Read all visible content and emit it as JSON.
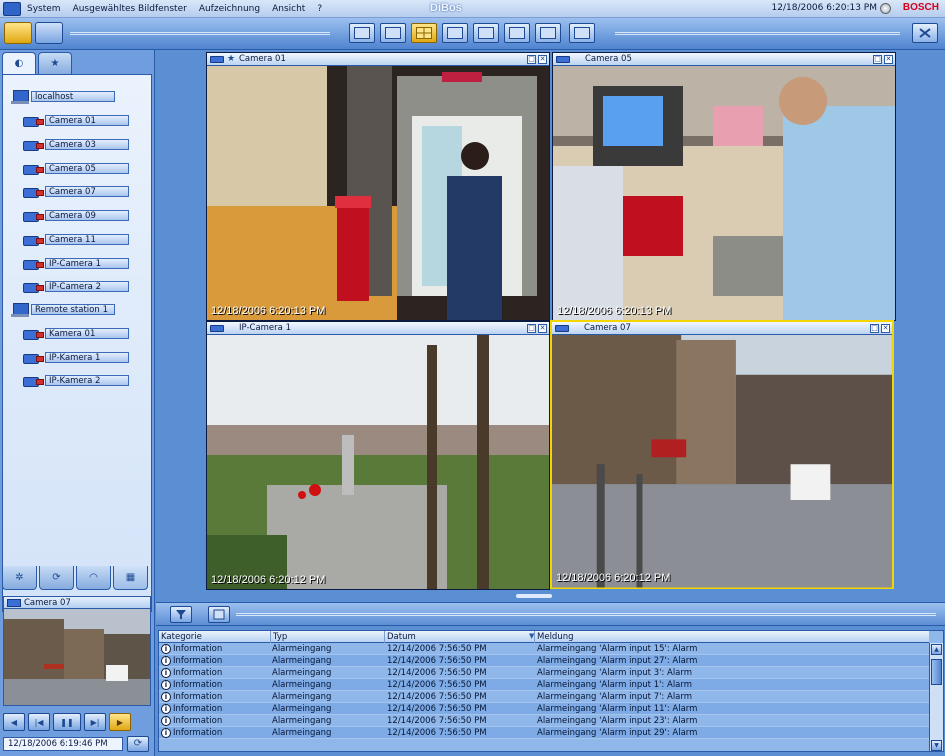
{
  "menu": {
    "items": [
      "System",
      "Ausgewähltes Bildfenster",
      "Aufzeichnung",
      "Ansicht",
      "?"
    ],
    "title": "DiBos",
    "clock": "12/18/2006 6:20:13 PM",
    "brand": "BOSCH"
  },
  "tree": {
    "local_host": "localhost",
    "local_cameras": [
      "Camera 01",
      "Camera 03",
      "Camera 05",
      "Camera 07",
      "Camera 09",
      "Camera 11",
      "IP-Camera 1",
      "IP-Camera 2"
    ],
    "remote_station": "Remote station",
    "remote_station_count": "1",
    "remote_cameras": [
      "Kamera 01",
      "IP-Kamera 1",
      "IP-Kamera 2"
    ]
  },
  "preview": {
    "title": "Camera 07",
    "timestamp": "12/18/2006    6:19:46 PM"
  },
  "video_windows": [
    {
      "title": "Camera 01",
      "stamp": "12/18/2006 6:20:13 PM"
    },
    {
      "title": "Camera 05",
      "stamp": "12/18/2006 6:20:13 PM"
    },
    {
      "title": "IP-Camera 1",
      "stamp": "12/18/2006 6:20:12 PM"
    },
    {
      "title": "Camera 07",
      "stamp": "12/18/2006 6:20:12 PM"
    }
  ],
  "log": {
    "columns": [
      "Kategorie",
      "Typ",
      "Datum",
      "Meldung"
    ],
    "rows": [
      [
        "Information",
        "Alarmeingang",
        "12/14/2006 7:56:50 PM",
        "Alarmeingang 'Alarm input 15': Alarm"
      ],
      [
        "Information",
        "Alarmeingang",
        "12/14/2006 7:56:50 PM",
        "Alarmeingang 'Alarm input 27': Alarm"
      ],
      [
        "Information",
        "Alarmeingang",
        "12/14/2006 7:56:50 PM",
        "Alarmeingang 'Alarm input 3': Alarm"
      ],
      [
        "Information",
        "Alarmeingang",
        "12/14/2006 7:56:50 PM",
        "Alarmeingang 'Alarm input 1': Alarm"
      ],
      [
        "Information",
        "Alarmeingang",
        "12/14/2006 7:56:50 PM",
        "Alarmeingang 'Alarm input 7': Alarm"
      ],
      [
        "Information",
        "Alarmeingang",
        "12/14/2006 7:56:50 PM",
        "Alarmeingang 'Alarm input 11': Alarm"
      ],
      [
        "Information",
        "Alarmeingang",
        "12/14/2006 7:56:50 PM",
        "Alarmeingang 'Alarm input 23': Alarm"
      ],
      [
        "Information",
        "Alarmeingang",
        "12/14/2006 7:56:50 PM",
        "Alarmeingang 'Alarm input 29': Alarm"
      ]
    ]
  },
  "colors": {
    "accent": "#4f84d0",
    "selected_border": "#f3d600",
    "active_button": "#e0a812",
    "brand": "#d5001c"
  }
}
